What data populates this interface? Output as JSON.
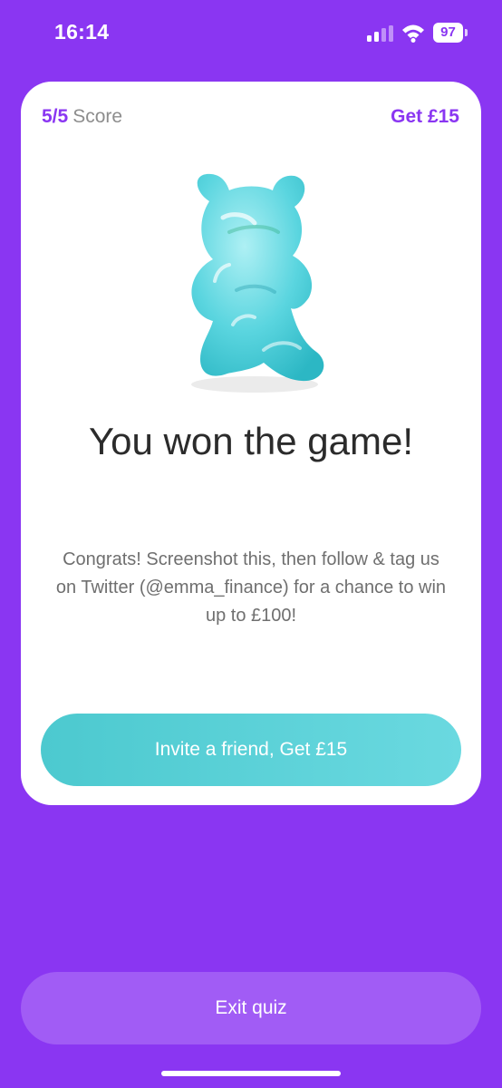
{
  "status_bar": {
    "time": "16:14",
    "battery": "97"
  },
  "card": {
    "score_value": "5/5",
    "score_label": "Score",
    "bonus_link": "Get £15",
    "headline": "You won the game!",
    "body": "Congrats! Screenshot this, then follow & tag us on Twitter (@emma_finance) for a chance to win up to  £100!",
    "invite_button": "Invite a friend, Get £15"
  },
  "exit_button": "Exit quiz",
  "colors": {
    "background": "#8a36f2",
    "accent": "#8a36f2",
    "invite_button": "#5fd3db",
    "exit_button": "#a15cf5",
    "gummy_bear": "#57d5de"
  },
  "icons": [
    "cellular-signal-icon",
    "wifi-icon",
    "battery-icon",
    "gummy-bear-icon"
  ]
}
